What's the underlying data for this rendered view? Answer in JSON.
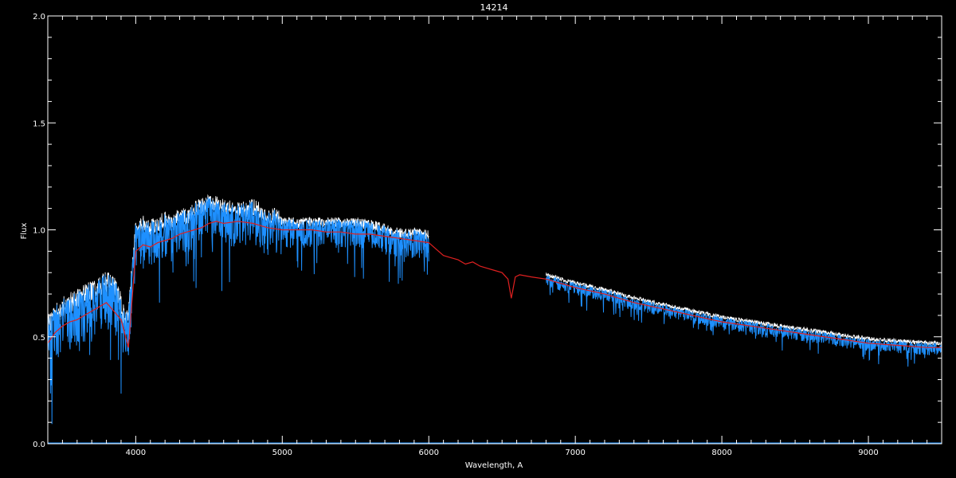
{
  "chart_data": {
    "type": "line",
    "title": "14214",
    "xlabel": "Wavelength, A",
    "ylabel": "Flux",
    "xlim": [
      3400,
      9500
    ],
    "ylim": [
      0.0,
      2.0
    ],
    "x_ticks": [
      4000,
      5000,
      6000,
      7000,
      8000,
      9000
    ],
    "x_tick_labels": [
      "4000",
      "5000",
      "6000",
      "7000",
      "8000",
      "9000"
    ],
    "y_ticks": [
      0.0,
      0.5,
      1.0,
      1.5,
      2.0
    ],
    "y_tick_labels": [
      "0.0",
      "0.5",
      "1.0",
      "1.5",
      "2.0"
    ],
    "grid": false,
    "colors": {
      "background": "#000000",
      "axes": "#ffffff",
      "observed": "#1e90ff",
      "observed_upper": "#ffffff",
      "model": "#e02020"
    },
    "series": [
      {
        "color": "#1e90ff",
        "segments": [
          {
            "x": [
              3400,
              3450,
              3500,
              3550,
              3600,
              3650,
              3700,
              3750,
              3800,
              3850,
              3900,
              3930,
              3950,
              3970,
              4000,
              4050,
              4100,
              4150,
              4200,
              4250,
              4300,
              4350,
              4400,
              4450,
              4500,
              4550,
              4600,
              4650,
              4700,
              4750,
              4800,
              4850,
              4900,
              4950,
              5000,
              5100,
              5200,
              5300,
              5400,
              5500,
              5600,
              5700,
              5800,
              5900,
              6000
            ],
            "y": [
              0.5,
              0.55,
              0.58,
              0.6,
              0.62,
              0.64,
              0.66,
              0.68,
              0.7,
              0.68,
              0.6,
              0.5,
              0.55,
              0.7,
              0.95,
              0.98,
              0.96,
              0.98,
              1.0,
              0.98,
              1.02,
              1.01,
              1.05,
              1.06,
              1.08,
              1.07,
              1.06,
              1.05,
              1.05,
              1.05,
              1.06,
              1.04,
              1.0,
              1.02,
              1.0,
              1.0,
              1.0,
              1.0,
              1.0,
              1.0,
              0.99,
              0.97,
              0.95,
              0.95,
              0.94
            ]
          },
          {
            "x": [
              6800,
              7000,
              7200,
              7400,
              7600,
              7800,
              8000,
              8200,
              8400,
              8600,
              8800,
              9000,
              9200,
              9400,
              9500
            ],
            "y": [
              0.77,
              0.73,
              0.7,
              0.66,
              0.63,
              0.6,
              0.57,
              0.55,
              0.53,
              0.51,
              0.49,
              0.47,
              0.46,
              0.45,
              0.45
            ]
          }
        ]
      },
      {
        "color": "#e02020",
        "segments": [
          {
            "x": [
              3400,
              3450,
              3500,
              3550,
              3600,
              3650,
              3700,
              3750,
              3800,
              3850,
              3900,
              3950,
              4000,
              4050,
              4100,
              4150,
              4200,
              4250,
              4300,
              4350,
              4400,
              4450,
              4500,
              4550,
              4600,
              4700,
              4800,
              4900,
              5000,
              5100,
              5200,
              5300,
              5400,
              5500,
              5600,
              5700,
              5800,
              5900,
              6000,
              6050,
              6100,
              6150,
              6200,
              6250,
              6300,
              6350,
              6400,
              6450,
              6500,
              6540,
              6563,
              6590,
              6620,
              6700,
              6800,
              7000,
              7200,
              7400,
              7600,
              7800,
              8000,
              8200,
              8400,
              8600,
              8800,
              9000,
              9200,
              9400,
              9500
            ],
            "y": [
              0.47,
              0.52,
              0.55,
              0.57,
              0.58,
              0.6,
              0.62,
              0.64,
              0.66,
              0.62,
              0.58,
              0.45,
              0.9,
              0.93,
              0.92,
              0.94,
              0.95,
              0.96,
              0.98,
              0.99,
              1.0,
              1.01,
              1.03,
              1.04,
              1.03,
              1.04,
              1.03,
              1.01,
              1.0,
              1.0,
              1.0,
              0.99,
              0.99,
              0.98,
              0.98,
              0.97,
              0.96,
              0.95,
              0.94,
              0.91,
              0.88,
              0.87,
              0.86,
              0.84,
              0.85,
              0.83,
              0.82,
              0.81,
              0.8,
              0.77,
              0.68,
              0.78,
              0.79,
              0.78,
              0.77,
              0.73,
              0.7,
              0.66,
              0.63,
              0.6,
              0.57,
              0.55,
              0.53,
              0.51,
              0.49,
              0.47,
              0.46,
              0.45,
              0.45
            ]
          }
        ]
      }
    ]
  }
}
